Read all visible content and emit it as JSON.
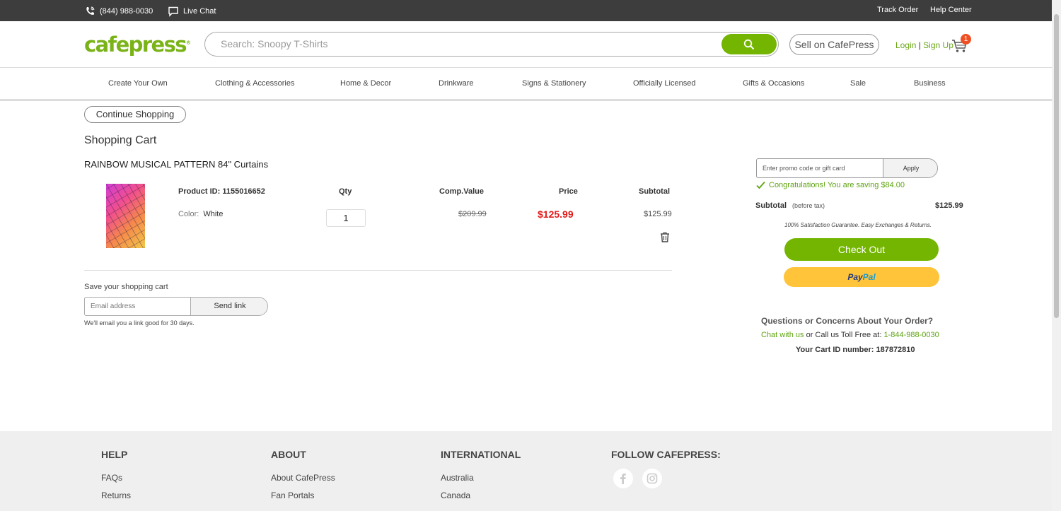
{
  "topbar": {
    "phone": "(844) 988-0030",
    "live_chat": "Live Chat",
    "track_order": "Track Order",
    "help_center": "Help Center"
  },
  "header": {
    "logo": "cafepress",
    "search_placeholder": "Search: Snoopy T-Shirts",
    "sell": "Sell on CafePress",
    "login": "Login",
    "signup": "Sign Up",
    "cart_count": "1"
  },
  "nav": {
    "items": [
      "Create Your Own",
      "Clothing & Accessories",
      "Home & Decor",
      "Drinkware",
      "Signs & Stationery",
      "Officially Licensed",
      "Gifts & Occasions",
      "Sale",
      "Business"
    ]
  },
  "cart": {
    "continue": "Continue Shopping",
    "title": "Shopping Cart",
    "product_name": "RAINBOW MUSICAL PATTERN 84\" Curtains",
    "product_id": "Product ID: 1155016652",
    "color_label": "Color:",
    "color_value": "White",
    "headers": {
      "qty": "Qty",
      "comp": "Comp.Value",
      "price": "Price",
      "subtotal": "Subtotal"
    },
    "qty": "1",
    "comp_value": "$209.99",
    "price": "$125.99",
    "subtotal": "$125.99",
    "save_label": "Save your shopping cart",
    "email_placeholder": "Email address",
    "send_link": "Send link",
    "email_note": "We'll email you a link good for 30 days."
  },
  "summary": {
    "promo_placeholder": "Enter promo code or gift card",
    "apply": "Apply",
    "congrats": "Congratulations! You are saving $84.00",
    "subtotal_label": "Subtotal",
    "before_tax": "(before tax)",
    "subtotal_value": "$125.99",
    "guarantee": "100% Satisfaction Guarantee. Easy Exchanges & Returns.",
    "checkout": "Check Out",
    "paypal_1": "Pay",
    "paypal_2": "Pal",
    "questions": "Questions or Concerns About Your Order?",
    "chat": "Chat with us",
    "call": " or Call us Toll Free at: ",
    "tollfree": "1-844-988-0030",
    "cart_id": "Your Cart ID number: 187872810"
  },
  "footer": {
    "help": {
      "heading": "HELP",
      "links": [
        "FAQs",
        "Returns"
      ]
    },
    "about": {
      "heading": "ABOUT",
      "links": [
        "About CafePress",
        "Fan Portals"
      ]
    },
    "international": {
      "heading": "INTERNATIONAL",
      "links": [
        "Australia",
        "Canada"
      ]
    },
    "follow": {
      "heading": "FOLLOW CAFEPRESS:"
    }
  },
  "colors": {
    "brand_green": "#73b500",
    "price_red": "#e21b1b",
    "paypal_yellow": "#ffc439",
    "badge": "#f04e23"
  },
  "icons": [
    "phone-icon",
    "chat-icon",
    "search-icon",
    "cart-icon",
    "trash-icon",
    "check-icon",
    "facebook-icon",
    "instagram-icon"
  ]
}
